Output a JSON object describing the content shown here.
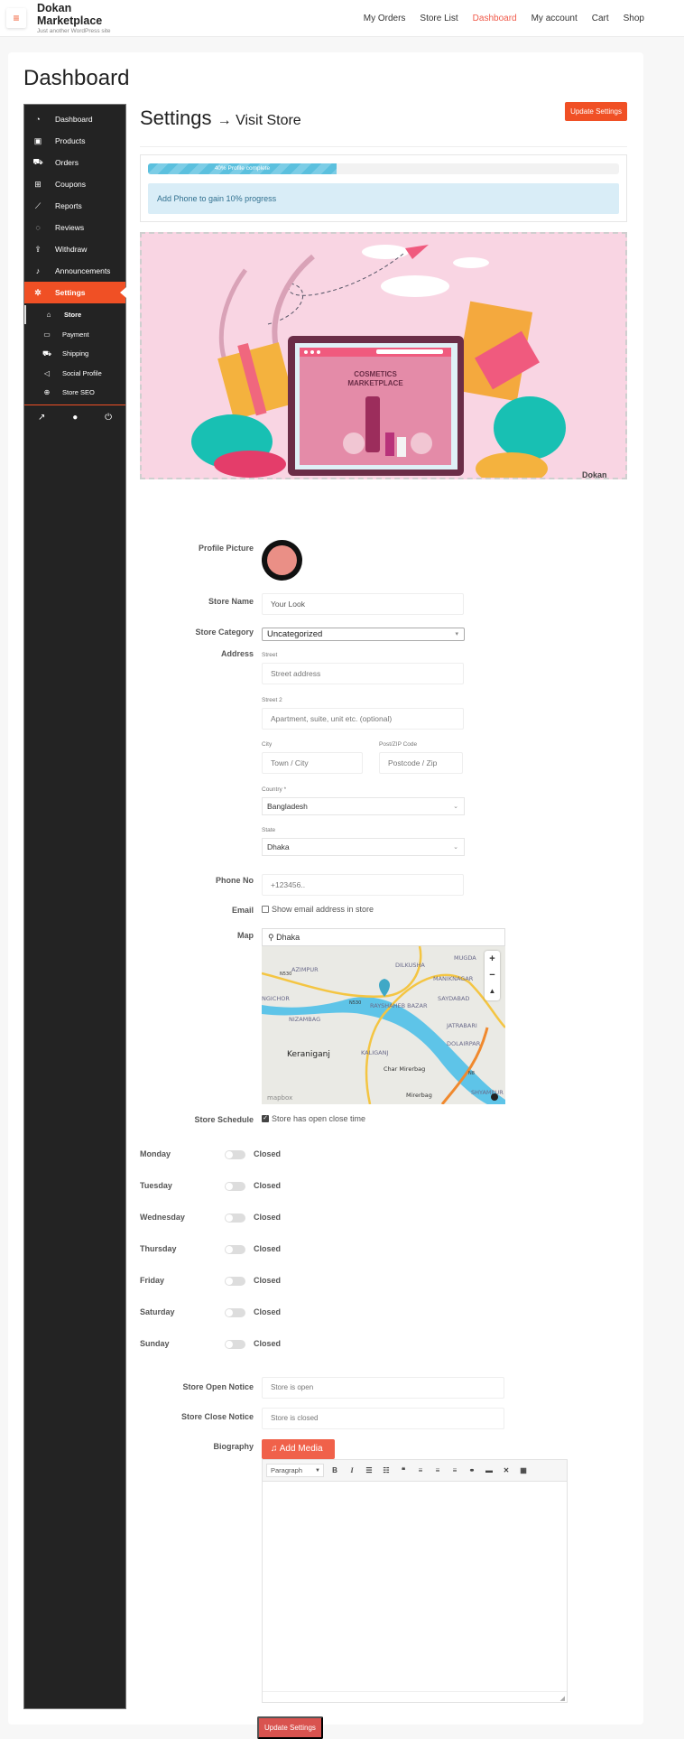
{
  "site": {
    "title": "Dokan Marketplace",
    "tagline": "Just another WordPress site",
    "menu_icon": "hamburger-icon"
  },
  "nav": [
    {
      "label": "My Orders",
      "active": false
    },
    {
      "label": "Store List",
      "active": false
    },
    {
      "label": "Dashboard",
      "active": true
    },
    {
      "label": "My account",
      "active": false
    },
    {
      "label": "Cart",
      "active": false
    },
    {
      "label": "Shop",
      "active": false
    }
  ],
  "page_title": "Dashboard",
  "sidebar": {
    "items": [
      {
        "label": "Dashboard",
        "icon": "tachometer-icon"
      },
      {
        "label": "Products",
        "icon": "briefcase-icon"
      },
      {
        "label": "Orders",
        "icon": "cart-icon"
      },
      {
        "label": "Coupons",
        "icon": "gift-icon"
      },
      {
        "label": "Reports",
        "icon": "chart-icon"
      },
      {
        "label": "Reviews",
        "icon": "comments-icon"
      },
      {
        "label": "Withdraw",
        "icon": "upload-icon"
      },
      {
        "label": "Announcements",
        "icon": "bell-icon"
      },
      {
        "label": "Settings",
        "icon": "gear-icon",
        "active": true
      }
    ],
    "sub_items": [
      {
        "label": "Store",
        "icon": "bank-icon",
        "current": true
      },
      {
        "label": "Payment",
        "icon": "credit-card-icon"
      },
      {
        "label": "Shipping",
        "icon": "truck-icon"
      },
      {
        "label": "Social Profile",
        "icon": "share-icon"
      },
      {
        "label": "Store SEO",
        "icon": "globe-icon"
      }
    ],
    "bottom_icons": [
      "external-link-icon",
      "user-icon",
      "power-icon"
    ]
  },
  "settings": {
    "title": "Settings",
    "arrow": "→",
    "visit_store": "Visit Store",
    "update_button": "Update Settings",
    "progress": {
      "percent": 40,
      "label": "40% Profile complete",
      "message": "Add Phone to gain 10% progress"
    },
    "banner": {
      "headline_line1": "COSMETICS",
      "headline_line2": "MARKETPLACE",
      "watermark": "Dokan"
    },
    "form": {
      "profile_picture_label": "Profile Picture",
      "store_name_label": "Store Name",
      "store_name_value": "Your Look",
      "store_category_label": "Store Category",
      "store_category_value": "Uncategorized",
      "address_label": "Address",
      "street_label": "Street",
      "street_placeholder": "Street address",
      "street2_label": "Street 2",
      "street2_placeholder": "Apartment, suite, unit etc. (optional)",
      "city_label": "City",
      "city_placeholder": "Town / City",
      "zip_label": "Post/ZIP Code",
      "zip_placeholder": "Postcode / Zip",
      "country_label": "Country *",
      "country_value": "Bangladesh",
      "state_label": "State",
      "state_value": "Dhaka",
      "phone_label": "Phone No",
      "phone_placeholder": "+123456..",
      "email_label": "Email",
      "email_checkbox_label": "Show email address in store",
      "email_checked": false,
      "map_label": "Map",
      "map_search_value": "Dhaka",
      "map_places": [
        "AZIMPUR",
        "DILKUSHA",
        "MUGDA",
        "MANIKNAGAR",
        "NGICHOR",
        "SAYDABAD",
        "RAYSHAHEB BAZAR",
        "NIZAMBAG",
        "JATRABARI",
        "DOLAIRPAR",
        "Keraniganj",
        "KALIGANJ",
        "Char Mirerbag",
        "Mirerbag",
        "SHYAMPUR"
      ],
      "map_road_labels": [
        "N530",
        "N530",
        "N8"
      ],
      "map_attribution": "mapbox",
      "schedule_label": "Store Schedule",
      "schedule_checkbox_label": "Store has open close time",
      "schedule_checked": true,
      "days": [
        {
          "day": "Monday",
          "status": "Closed",
          "open": false
        },
        {
          "day": "Tuesday",
          "status": "Closed",
          "open": false
        },
        {
          "day": "Wednesday",
          "status": "Closed",
          "open": false
        },
        {
          "day": "Thursday",
          "status": "Closed",
          "open": false
        },
        {
          "day": "Friday",
          "status": "Closed",
          "open": false
        },
        {
          "day": "Saturday",
          "status": "Closed",
          "open": false
        },
        {
          "day": "Sunday",
          "status": "Closed",
          "open": false
        }
      ],
      "open_notice_label": "Store Open Notice",
      "open_notice_value": "Store is open",
      "close_notice_label": "Store Close Notice",
      "close_notice_value": "Store is closed",
      "biography_label": "Biography",
      "add_media_label": "Add Media",
      "paragraph_select": "Paragraph",
      "toolbar_buttons": [
        "bold-icon",
        "italic-icon",
        "bullet-list-icon",
        "numbered-list-icon",
        "blockquote-icon",
        "align-left-icon",
        "align-center-icon",
        "align-right-icon",
        "link-icon",
        "read-more-icon",
        "fullscreen-icon",
        "toolbar-toggle-icon"
      ]
    },
    "update_bottom_button": "Update Settings"
  },
  "colors": {
    "accent": "#f05025",
    "sidebar_bg": "#232323",
    "progress": "#5bc0de",
    "alert_bg": "#d9edf7",
    "alert_text": "#31708f",
    "bottom_button": "#d9534f",
    "banner_bg": "#f9d5e3"
  }
}
